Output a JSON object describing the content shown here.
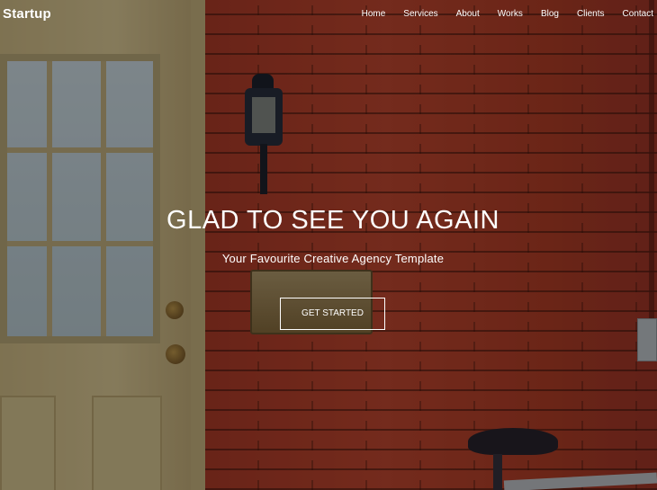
{
  "brand": {
    "name": "Startup"
  },
  "nav": {
    "items": [
      "Home",
      "Services",
      "About",
      "Works",
      "Blog",
      "Clients",
      "Contact"
    ]
  },
  "hero": {
    "headline": "GLAD TO SEE YOU AGAIN",
    "tagline": "Your Favourite Creative Agency Template",
    "cta_label": "GET STARTED"
  },
  "colors": {
    "text": "#ffffff",
    "overlay": "rgba(0,0,0,0.42)",
    "wall": "#c84a32",
    "door": "#e6d39d"
  }
}
